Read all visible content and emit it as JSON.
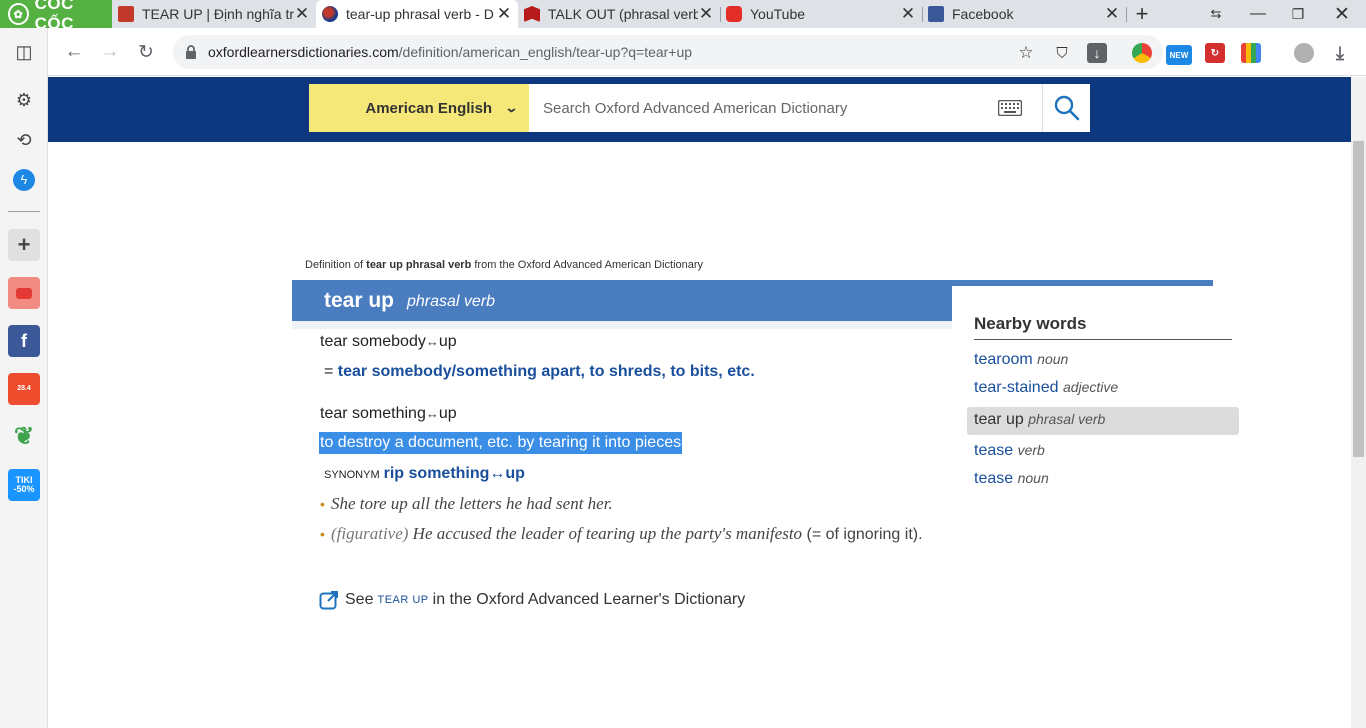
{
  "browser": {
    "brand": "CỐC CỐC",
    "tabs": [
      {
        "title": "TEAR UP | Định nghĩa tr",
        "active": false
      },
      {
        "title": "tear-up phrasal verb - D",
        "active": true
      },
      {
        "title": "TALK OUT (phrasal verb",
        "active": false
      },
      {
        "title": "YouTube",
        "active": false
      },
      {
        "title": "Facebook",
        "active": false
      }
    ],
    "new_tab": "+",
    "url_host": "oxfordlearnersdictionaries.com",
    "url_path": "/definition/american_english/tear-up?q=tear+up",
    "ext_new_badge": "NEW"
  },
  "sidebar": {
    "apps": [
      {
        "name": "youtube",
        "color": "#f28b82"
      },
      {
        "name": "facebook",
        "color": "#3b5998"
      },
      {
        "name": "shopee",
        "color": "#ee4d2d",
        "label": "28.4"
      },
      {
        "name": "tiki",
        "color": "#1a94ff",
        "label": "TIKI -50%"
      }
    ]
  },
  "header": {
    "dictionary_select": "American English",
    "search_placeholder": "Search Oxford Advanced American Dictionary"
  },
  "entry": {
    "source_prefix": "Definition of ",
    "source_bold": "tear up phrasal verb",
    "source_suffix": " from the Oxford Advanced American Dictionary",
    "headword": "tear up",
    "pos": "phrasal verb",
    "sense1_head": "tear somebody",
    "sense1_arrow": "↔",
    "sense1_tail": "up",
    "sense1_xref_eq": "= ",
    "sense1_xref": "tear somebody/something apart, to shreds, to bits, etc.",
    "sense2_head": "tear something",
    "sense2_arrow": "↔",
    "sense2_tail": "up",
    "sense2_def": "to destroy a document, etc. by tearing it into pieces",
    "synonym_label": "SYNONYM",
    "synonym": "rip something↔up",
    "example1": "She tore up all the letters he had sent her.",
    "example2_label": "(figurative)",
    "example2_text": " He accused the leader of tearing up the party's manifesto",
    "example2_gloss": " (= of ignoring it).",
    "see_prefix": "See ",
    "see_link": "TEAR UP",
    "see_suffix": " in the Oxford Advanced Learner's Dictionary"
  },
  "nearby": {
    "title": "Nearby words",
    "items": [
      {
        "word": "tearoom",
        "pos": "noun",
        "current": false
      },
      {
        "word": "tear-stained",
        "pos": "adjective",
        "current": false
      },
      {
        "word": "tear up",
        "pos": "phrasal verb",
        "current": true
      },
      {
        "word": "tease",
        "pos": "verb",
        "current": false
      },
      {
        "word": "tease",
        "pos": "noun",
        "current": false
      }
    ]
  }
}
